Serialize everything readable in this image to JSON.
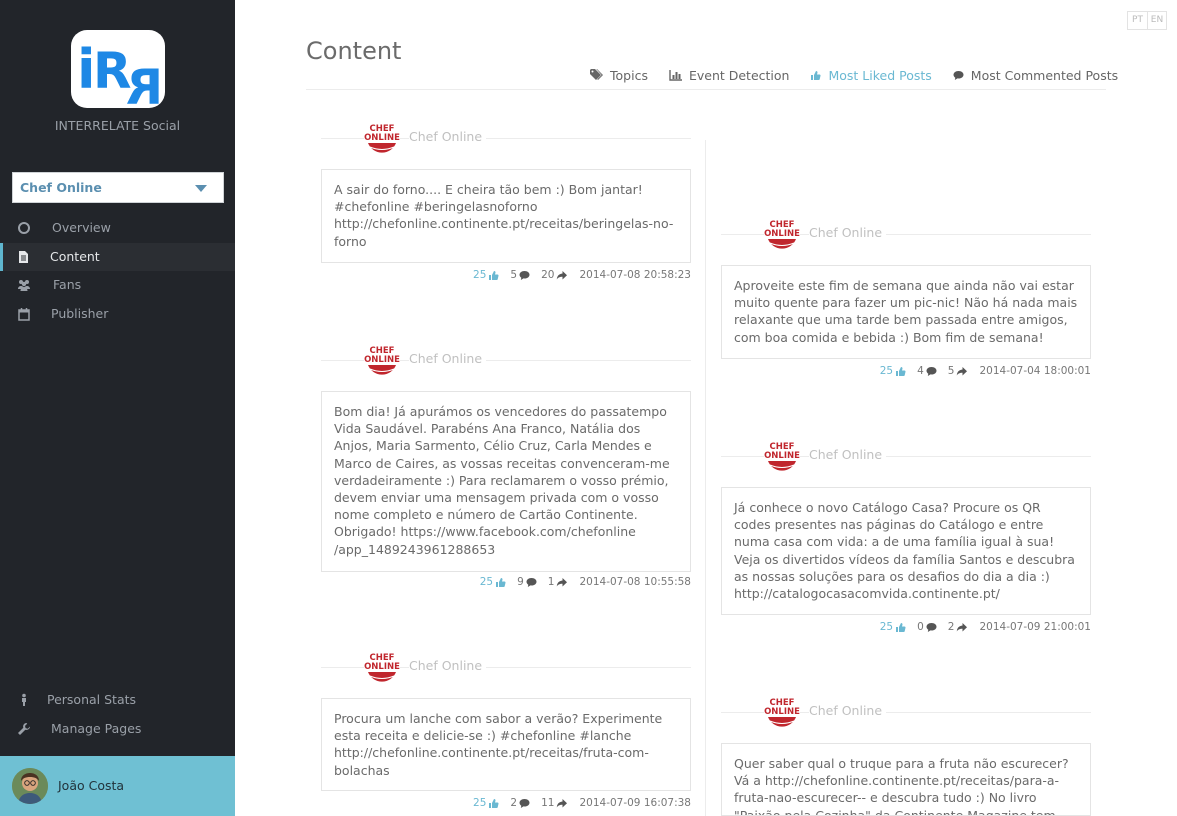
{
  "app": {
    "name": "INTERRELATE Social",
    "page_select": "Chef Online",
    "colors": {
      "sidebar": "#22252a",
      "accent": "#6fc0d3",
      "link": "#6ab8d2",
      "brand_blue": "#1e88e5"
    }
  },
  "sidebar": {
    "nav": [
      {
        "label": "Overview",
        "icon": "circle-icon",
        "active": false
      },
      {
        "label": "Content",
        "icon": "document-icon",
        "active": true
      },
      {
        "label": "Fans",
        "icon": "users-icon",
        "active": false
      },
      {
        "label": "Publisher",
        "icon": "calendar-icon",
        "active": false
      }
    ],
    "bottom": [
      {
        "label": "Personal Stats",
        "icon": "person-icon"
      },
      {
        "label": "Manage Pages",
        "icon": "wrench-icon"
      }
    ],
    "user": {
      "name": "João Costa"
    }
  },
  "lang": {
    "pt": "PT",
    "en": "EN"
  },
  "header": {
    "title": "Content",
    "tabs": [
      {
        "label": "Topics",
        "icon": "tags-icon"
      },
      {
        "label": "Event Detection",
        "icon": "bar-chart-icon"
      },
      {
        "label": "Most Liked Posts",
        "icon": "thumbs-up-icon",
        "active": true
      },
      {
        "label": "Most Commented Posts",
        "icon": "comment-icon"
      }
    ]
  },
  "posts": [
    {
      "author": "Chef Online",
      "text": "A sair do forno.... E cheira tão bem :) Bom jantar! #chefonline #beringelasnoforno http://chefonline.continente.pt/receitas/beringelas-no-forno",
      "likes": "25",
      "comments": "5",
      "shares": "20",
      "date": "2014-07-08 20:58:23"
    },
    {
      "author": "Chef Online",
      "text": "Bom dia! Já apurámos os vencedores do passatempo Vida Saudável. Parabéns Ana Franco, Natália dos Anjos, Maria Sarmento, Célio Cruz, Carla Mendes e Marco de Caires, as vossas receitas convenceram-me verdadeiramente :) Para reclamarem o vosso prémio, devem enviar uma mensagem privada com o vosso nome completo e número de Cartão Continente. Obrigado! https://www.facebook.com/chefonline /app_1489243961288653",
      "likes": "25",
      "comments": "9",
      "shares": "1",
      "date": "2014-07-08 10:55:58"
    },
    {
      "author": "Chef Online",
      "text": "Procura um lanche com sabor a verão? Experimente esta receita e delicie-se :) #chefonline #lanche http://chefonline.continente.pt/receitas/fruta-com-bolachas",
      "likes": "25",
      "comments": "2",
      "shares": "11",
      "date": "2014-07-09 16:07:38"
    },
    {
      "author": "Chef Online",
      "text": "Aproveite este fim de semana que ainda não vai estar muito quente para fazer um pic-nic! Não há nada mais relaxante que uma tarde bem passada entre amigos, com boa comida e bebida :) Bom fim de semana!",
      "likes": "25",
      "comments": "4",
      "shares": "5",
      "date": "2014-07-04 18:00:01"
    },
    {
      "author": "Chef Online",
      "text": "Já conhece o novo Catálogo Casa? Procure os QR codes presentes nas páginas do Catálogo e entre numa casa com vida: a de uma família igual à sua! Veja os divertidos vídeos da família Santos e descubra as nossas soluções para os desafios do dia a dia :) http://catalogocasacomvida.continente.pt/",
      "likes": "25",
      "comments": "0",
      "shares": "2",
      "date": "2014-07-09 21:00:01"
    },
    {
      "author": "Chef Online",
      "text": "Quer saber qual o truque para a fruta não escurecer? Vá a http://chefonline.continente.pt/receitas/para-a-fruta-nao-escurecer-- e descubra tudo :) No livro \"Paixão pela Cozinha\" da Continente Magazine tem este e muitos",
      "likes": "",
      "comments": "",
      "shares": "",
      "date": ""
    }
  ]
}
